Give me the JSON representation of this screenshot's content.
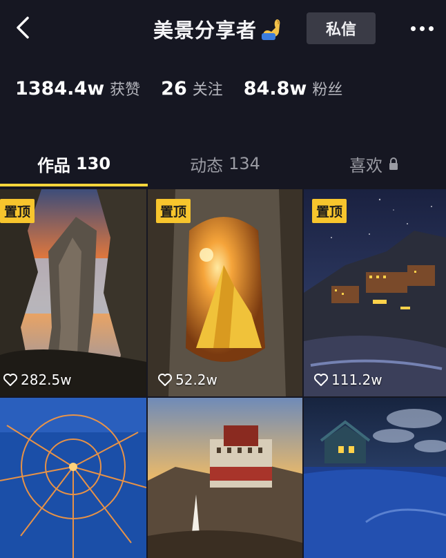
{
  "header": {
    "title": "美景分享者",
    "title_emoji_icon": "flexed-biceps-icon",
    "dm_label": "私信",
    "back_icon": "chevron-left-icon",
    "more_icon": "more-dots-icon"
  },
  "stats": [
    {
      "value": "1384.4w",
      "label": "获赞"
    },
    {
      "value": "26",
      "label": "关注"
    },
    {
      "value": "84.8w",
      "label": "粉丝"
    }
  ],
  "tabs": [
    {
      "label": "作品",
      "count": "130",
      "active": true
    },
    {
      "label": "动态",
      "count": "134",
      "active": false
    },
    {
      "label": "喜欢",
      "count": "",
      "active": false,
      "icon": "lock-icon"
    }
  ],
  "grid": {
    "pin_label": "置顶",
    "items": [
      {
        "pinned": true,
        "likes": "282.5w",
        "scene": "sunset rock arch over sea"
      },
      {
        "pinned": true,
        "likes": "52.2w",
        "scene": "golden mountain peak through rock window"
      },
      {
        "pinned": true,
        "likes": "111.2w",
        "scene": "lit monastery under starry sky"
      },
      {
        "pinned": false,
        "likes": "",
        "scene": "aerial view of glowing radial village"
      },
      {
        "pinned": false,
        "likes": "",
        "scene": "Potala palace at sunset"
      },
      {
        "pinned": false,
        "likes": "",
        "scene": "cabin in snow under night sky"
      }
    ]
  },
  "colors": {
    "background": "#161722",
    "accent": "#f7d53b",
    "pin_badge": "#f7c52d",
    "dm_button": "#3a3b46"
  }
}
